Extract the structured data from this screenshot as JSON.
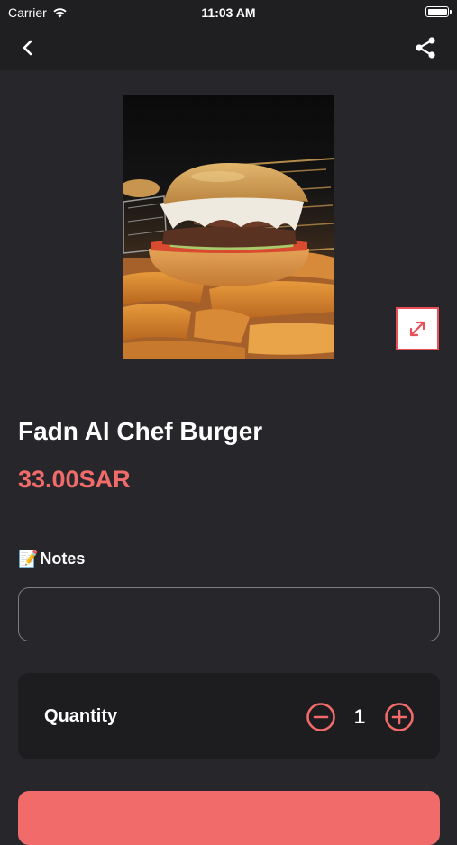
{
  "status_bar": {
    "carrier": "Carrier",
    "time": "11:03 AM"
  },
  "nav": {
    "back_icon": "chevron-left-icon",
    "share_icon": "share-icon"
  },
  "product": {
    "image_alt": "Fadn Al Chef Burger photo",
    "name": "Fadn Al Chef Burger",
    "price": "33.00SAR",
    "expand_icon": "expand-icon"
  },
  "notes": {
    "emoji": "📝",
    "label": "Notes",
    "value": "",
    "placeholder": ""
  },
  "quantity": {
    "label": "Quantity",
    "value": "1",
    "minus_icon": "minus-circle-icon",
    "plus_icon": "plus-circle-icon"
  },
  "colors": {
    "accent": "#f26b6b",
    "background": "#27272b",
    "bar": "#1f1f22",
    "card": "#1d1d20"
  }
}
